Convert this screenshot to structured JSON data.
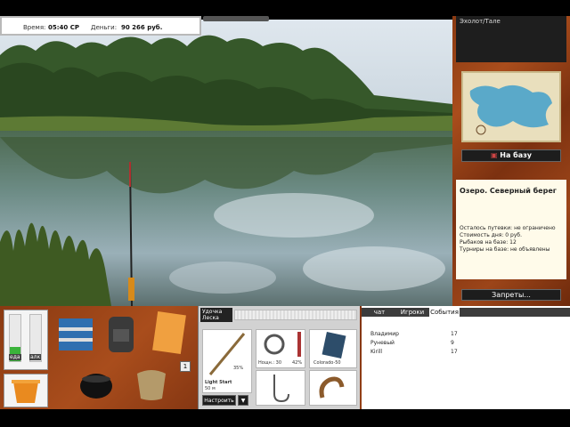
{
  "info": {
    "time_label": "Время:",
    "time_value": "05:40 СР",
    "money_label": "Деньги:",
    "money_value": "90 266 руб."
  },
  "sonar": {
    "title": "Эхолот/Тале"
  },
  "map": {
    "to_base_label": "На базу"
  },
  "location": {
    "title": "Озеро. Северный берег",
    "lines": [
      "Осталось путевки: не ограничено",
      "Стоимость дня: 0 руб.",
      "Рыбаков на базе: 12",
      "",
      "Турниры на базе: не объявлены"
    ]
  },
  "limits_button": "Запреты...",
  "gauges": {
    "left_label": "еда",
    "right_label": "алк",
    "left_level": 0.3,
    "right_level": 0
  },
  "inventory": {
    "count_badge": "1"
  },
  "gear": {
    "header_line1": "Удочка",
    "header_line2": "Леска",
    "rod_name": "Light Start",
    "rod_length": "50 м",
    "rod_percent": "35%",
    "reel_label": "Нощн.: 30",
    "reel_percent": "42%",
    "line_name": "Colorado-50",
    "hook_label": "",
    "bait_label": "",
    "setup_label": "Настроить",
    "drop_label": "▼"
  },
  "chat": {
    "tabs": [
      "чат",
      "Игроки",
      "События"
    ],
    "active_tab": 2,
    "players": [
      {
        "name": "Владимир",
        "score": "17"
      },
      {
        "name": "Руневый",
        "score": "9"
      },
      {
        "name": "Kirill",
        "score": "17"
      }
    ]
  },
  "colors": {
    "wood": "#8a3a12",
    "panel_bg": "#fffbea",
    "button_bg": "#1d1d1d"
  }
}
